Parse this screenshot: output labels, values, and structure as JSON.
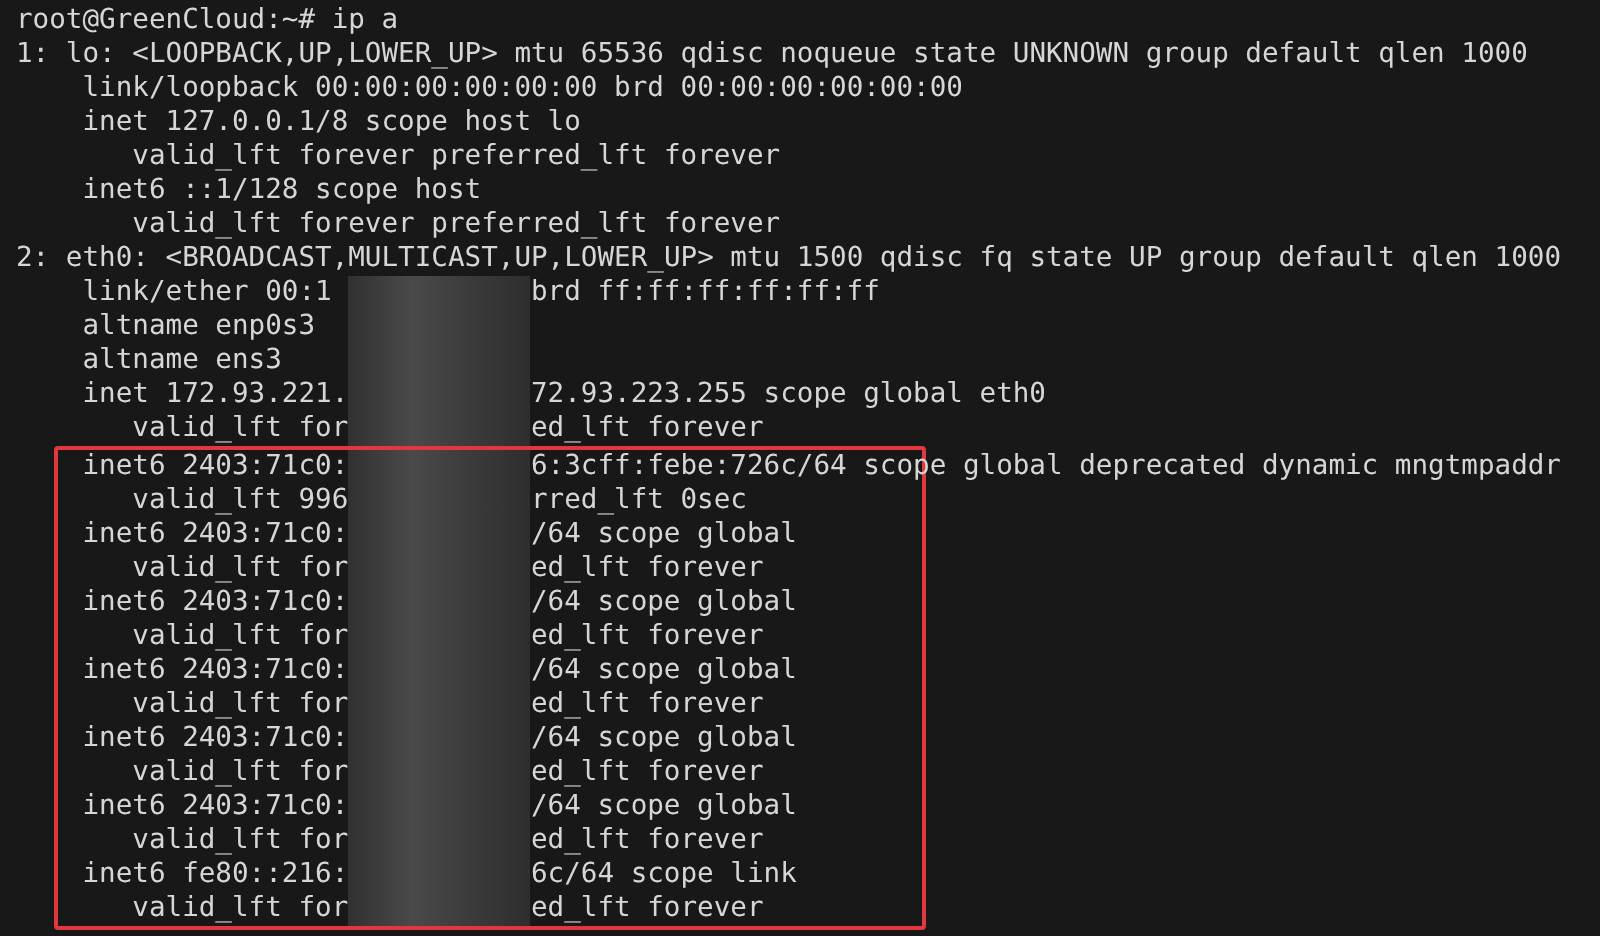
{
  "terminal": {
    "lines": [
      {
        "kind": "text",
        "text": "root@GreenCloud:~# ip a"
      },
      {
        "kind": "text",
        "text": "1: lo: <LOOPBACK,UP,LOWER_UP> mtu 65536 qdisc noqueue state UNKNOWN group default qlen 1000"
      },
      {
        "kind": "text",
        "text": "    link/loopback 00:00:00:00:00:00 brd 00:00:00:00:00:00"
      },
      {
        "kind": "text",
        "text": "    inet 127.0.0.1/8 scope host lo"
      },
      {
        "kind": "text",
        "text": "       valid_lft forever preferred_lft forever"
      },
      {
        "kind": "text",
        "text": "    inet6 ::1/128 scope host"
      },
      {
        "kind": "text",
        "text": "       valid_lft forever preferred_lft forever"
      },
      {
        "kind": "text",
        "text": "2: eth0: <BROADCAST,MULTICAST,UP,LOWER_UP> mtu 1500 qdisc fq state UP group default qlen 1000"
      },
      {
        "kind": "redacted",
        "left": "    link/ether 00:1",
        "right": "brd ff:ff:ff:ff:ff:ff"
      },
      {
        "kind": "redacted",
        "left": "    altname enp0s3"
      },
      {
        "kind": "redacted",
        "left": "    altname ens3"
      },
      {
        "kind": "redacted",
        "left": "    inet 172.93.221.",
        "right": "72.93.223.255 scope global eth0"
      },
      {
        "kind": "redacted",
        "left": "       valid_lft for",
        "right": "ed_lft forever"
      }
    ],
    "highlight_box": {
      "lines": [
        {
          "kind": "redacted",
          "left": "    inet6 2403:71c0:",
          "right": "6:3cff:febe:726c/64 scope global deprecated dynamic mngtmpaddr"
        },
        {
          "kind": "redacted",
          "left": "       valid_lft 996",
          "right": "rred_lft 0sec"
        },
        {
          "kind": "redacted",
          "left": "    inet6 2403:71c0:",
          "right": "/64 scope global"
        },
        {
          "kind": "redacted",
          "left": "       valid_lft for",
          "right": "ed_lft forever"
        },
        {
          "kind": "redacted",
          "left": "    inet6 2403:71c0:",
          "right": "/64 scope global"
        },
        {
          "kind": "redacted",
          "left": "       valid_lft for",
          "right": "ed_lft forever"
        },
        {
          "kind": "redacted",
          "left": "    inet6 2403:71c0:",
          "right": "/64 scope global"
        },
        {
          "kind": "redacted",
          "left": "       valid_lft for",
          "right": "ed_lft forever"
        },
        {
          "kind": "redacted",
          "left": "    inet6 2403:71c0:",
          "right": "/64 scope global"
        },
        {
          "kind": "redacted",
          "left": "       valid_lft for",
          "right": "ed_lft forever"
        },
        {
          "kind": "redacted",
          "left": "    inet6 2403:71c0:",
          "right": "/64 scope global"
        },
        {
          "kind": "redacted",
          "left": "       valid_lft for",
          "right": "ed_lft forever"
        },
        {
          "kind": "redacted",
          "left": "    inet6 fe80::216:",
          "right": "6c/64 scope link"
        },
        {
          "kind": "redacted",
          "left": "       valid_lft for",
          "right": "ed_lft forever"
        }
      ]
    }
  }
}
